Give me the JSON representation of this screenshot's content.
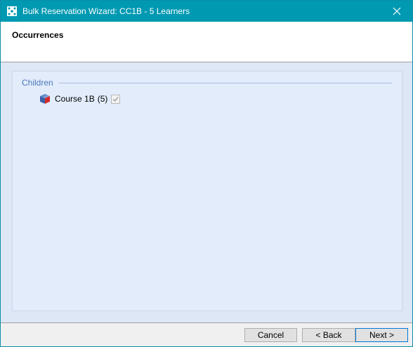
{
  "window": {
    "title": "Bulk Reservation Wizard: CC1B - 5 Learners",
    "close_icon": "close-icon",
    "app_icon": "wizard-app-icon"
  },
  "header": {
    "title": "Occurrences"
  },
  "group": {
    "title": "Children",
    "items": [
      {
        "label": "Course 1B",
        "count": "(5)",
        "checked": true,
        "icon": "course-cube-icon"
      }
    ]
  },
  "footer": {
    "cancel_label": "Cancel",
    "back_label": "< Back",
    "next_label": "Next >"
  },
  "colors": {
    "titlebar": "#0099b2",
    "content_bg": "#e3ecfb",
    "group_title": "#4a78b8"
  }
}
